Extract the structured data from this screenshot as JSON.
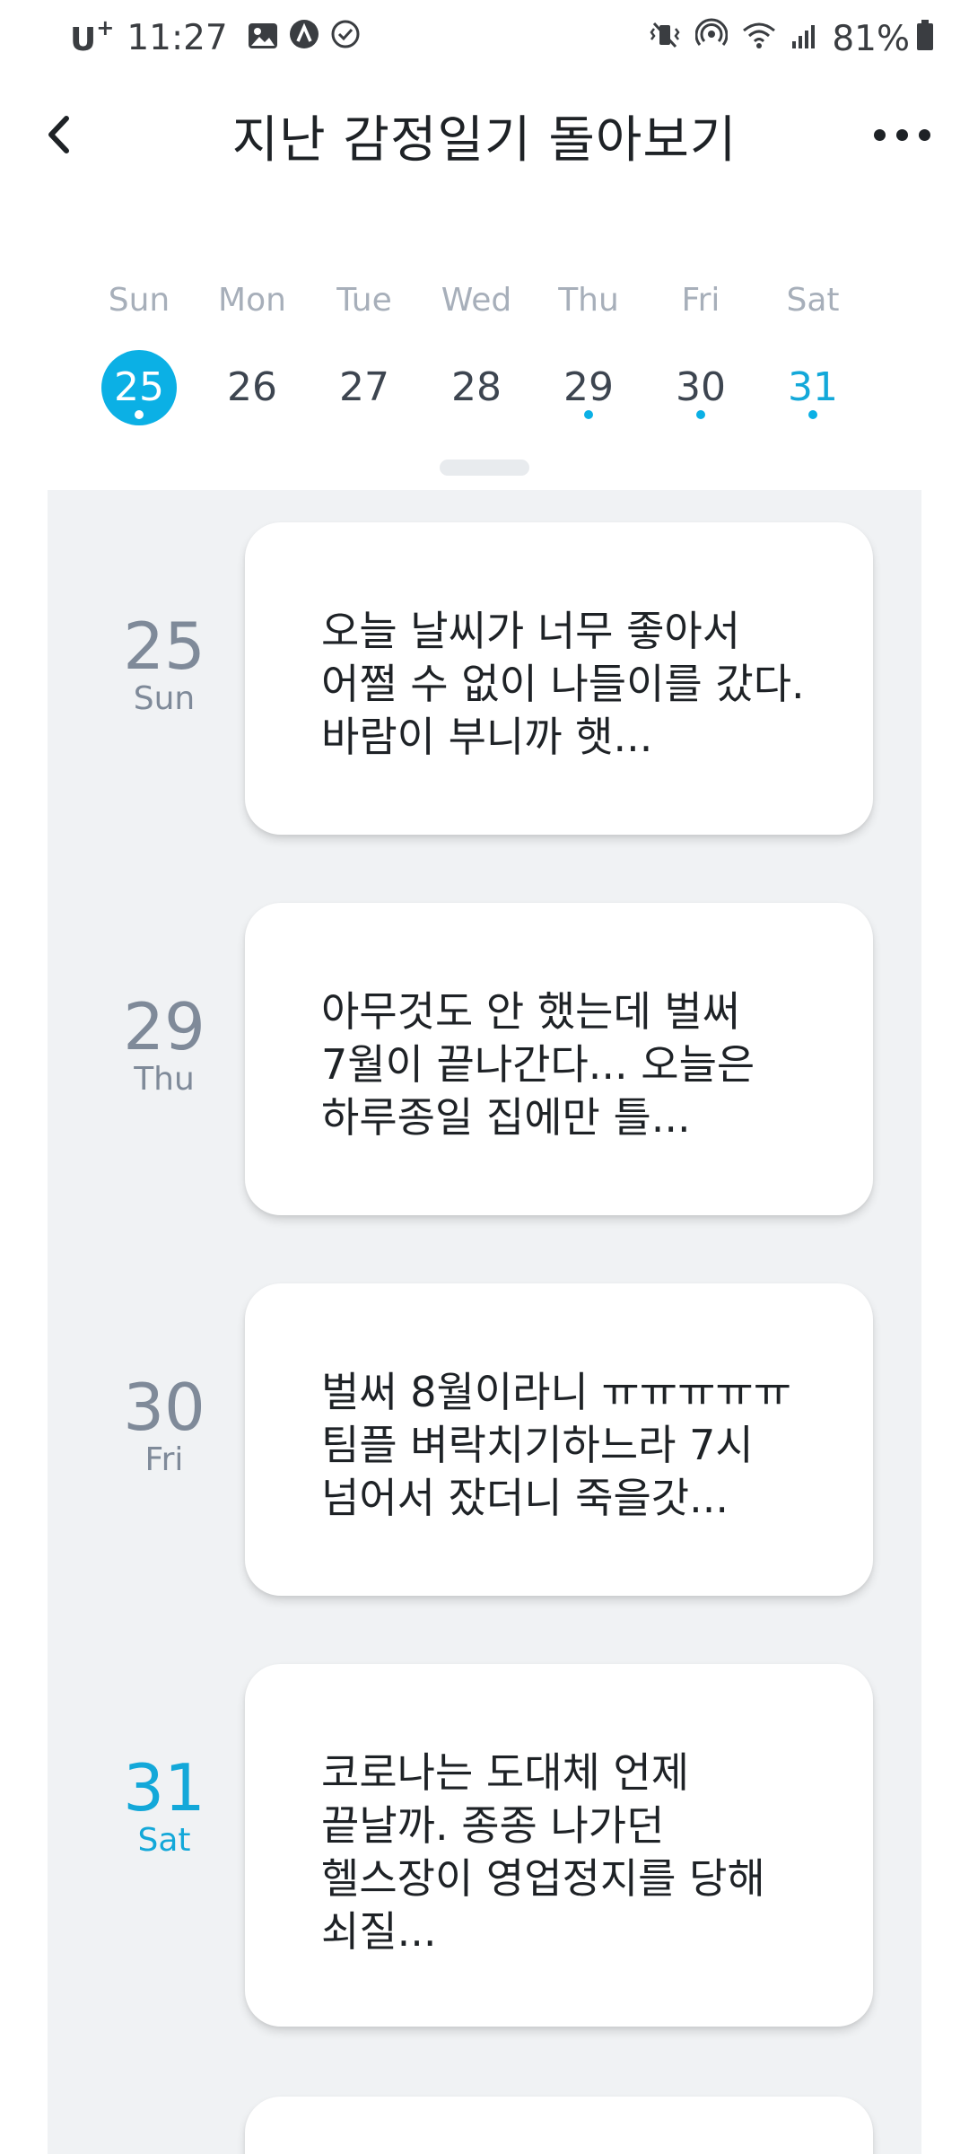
{
  "status_bar": {
    "carrier": "U",
    "carrier_sup": "+",
    "time": "11:27",
    "battery": "81%"
  },
  "header": {
    "title": "지난 감정일기 돌아보기"
  },
  "week": {
    "days": [
      {
        "name": "Sun",
        "num": "25",
        "selected": true,
        "has_entry": true
      },
      {
        "name": "Mon",
        "num": "26",
        "selected": false,
        "has_entry": false
      },
      {
        "name": "Tue",
        "num": "27",
        "selected": false,
        "has_entry": false
      },
      {
        "name": "Wed",
        "num": "28",
        "selected": false,
        "has_entry": false
      },
      {
        "name": "Thu",
        "num": "29",
        "selected": false,
        "has_entry": true
      },
      {
        "name": "Fri",
        "num": "30",
        "selected": false,
        "has_entry": true
      },
      {
        "name": "Sat",
        "num": "31",
        "selected": false,
        "has_entry": true
      }
    ]
  },
  "entries": [
    {
      "num": "25",
      "dow": "Sun",
      "text": "오늘 날씨가 너무 좋아서\n어쩔 수 없이 나들이를 갔다.\n바람이 부니까 햇..."
    },
    {
      "num": "29",
      "dow": "Thu",
      "text": "아무것도 안 했는데 벌써\n7월이 끝나간다... 오늘은\n하루종일 집에만 틀..."
    },
    {
      "num": "30",
      "dow": "Fri",
      "text": "벌써 8월이라니 ㅠㅠㅠㅠㅠ\n팀플 벼락치기하느라 7시\n넘어서 잤더니 죽을갓..."
    },
    {
      "num": "31",
      "dow": "Sat",
      "text": "코로나는 도대체 언제\n끝날까. 종종 나가던\n헬스장이 영업정지를 당해\n쇠질..."
    }
  ],
  "colors": {
    "accent": "#0bb0e5",
    "panel_bg": "#f0f2f4",
    "muted": "#7f8a99"
  }
}
